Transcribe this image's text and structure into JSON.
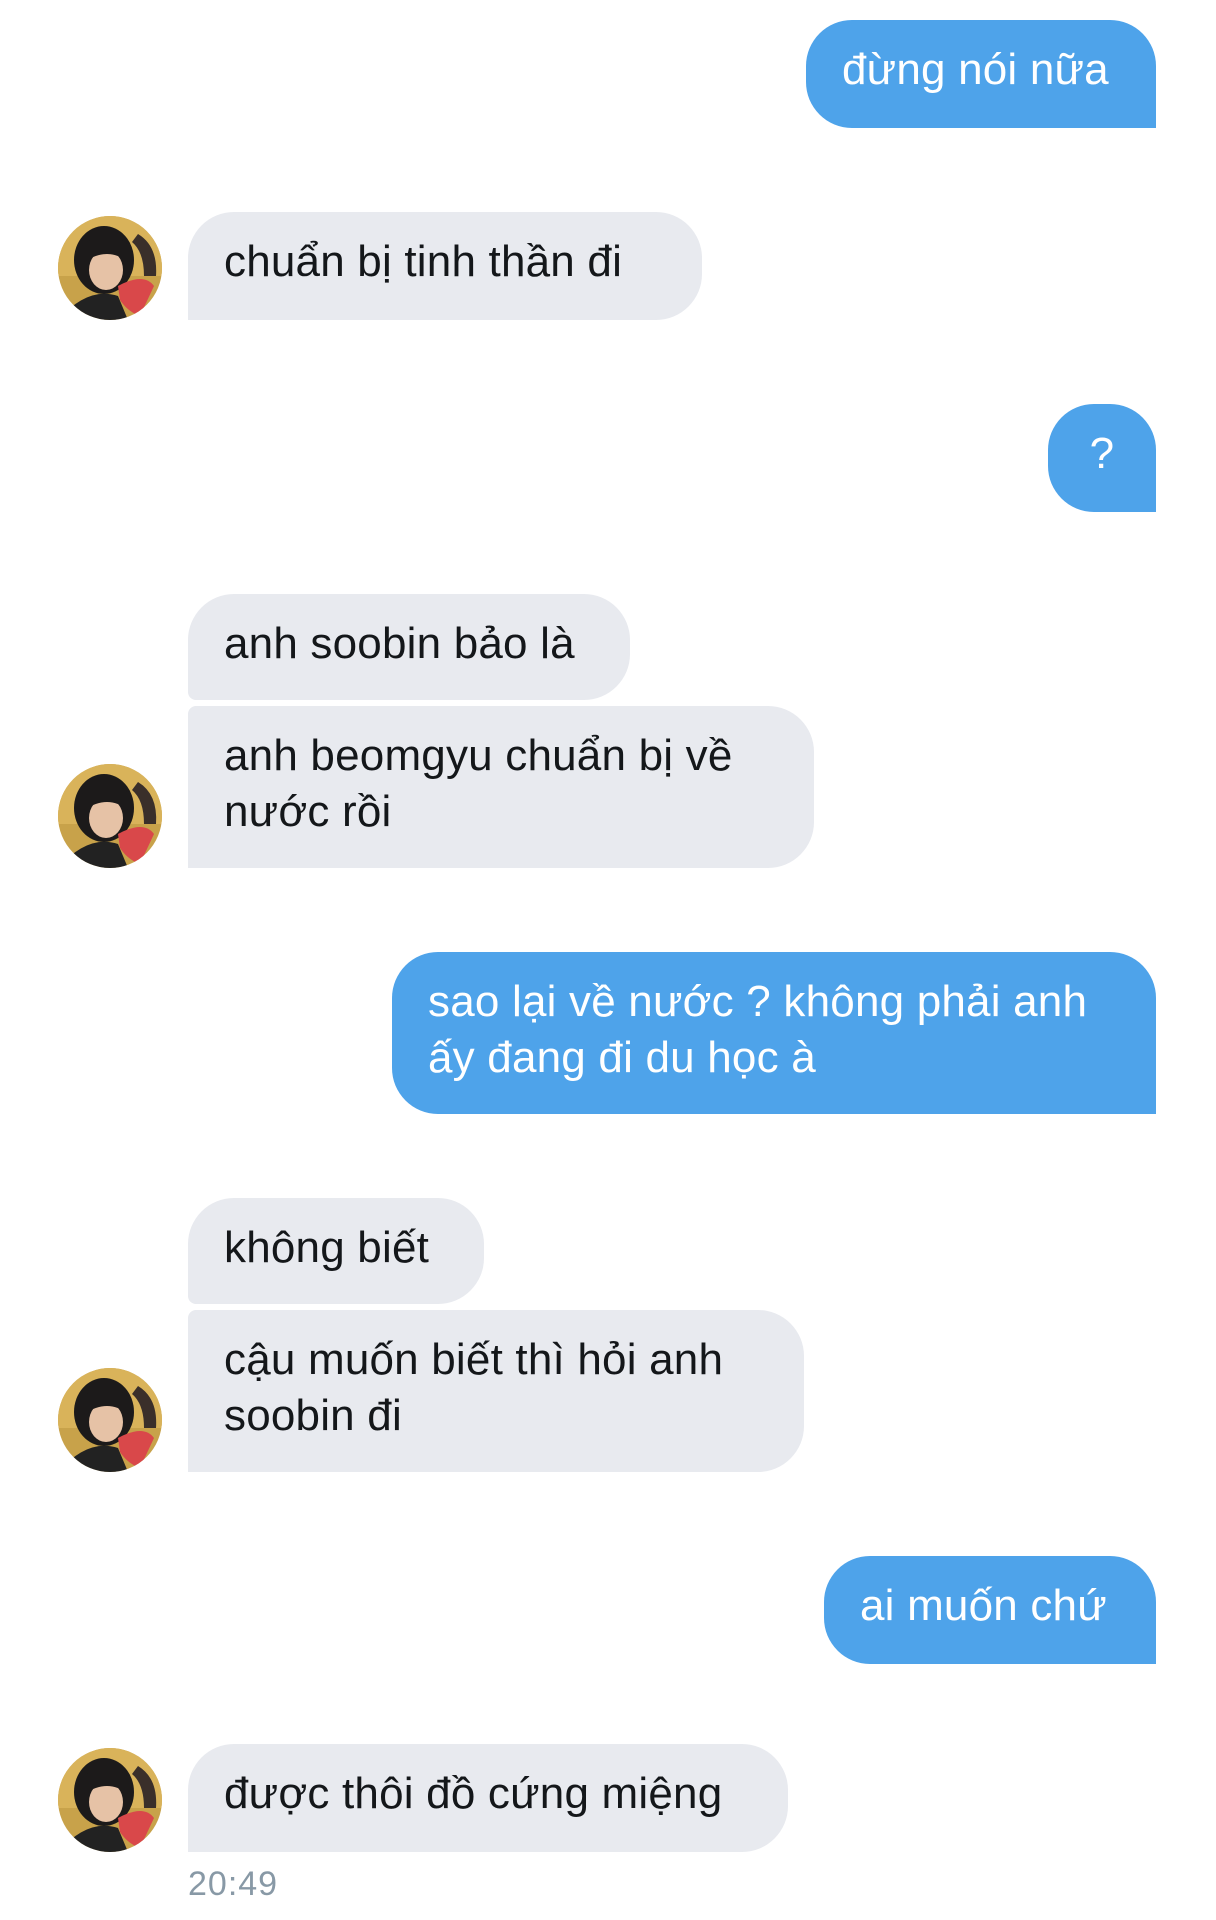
{
  "conversation": {
    "messages": [
      {
        "direction": "outgoing",
        "text": "đừng nói nữa"
      },
      {
        "direction": "incoming",
        "text": "chuẩn bị tinh thần đi"
      },
      {
        "direction": "outgoing",
        "text": "?"
      },
      {
        "direction": "incoming",
        "text": "anh soobin bảo là"
      },
      {
        "direction": "incoming",
        "text": "anh beomgyu chuẩn bị về nước rồi"
      },
      {
        "direction": "outgoing",
        "text": "sao lại về nước ? không phải anh ấy đang đi du học à"
      },
      {
        "direction": "incoming",
        "text": "không biết"
      },
      {
        "direction": "incoming",
        "text": "cậu muốn biết thì hỏi anh soobin đi"
      },
      {
        "direction": "outgoing",
        "text": "ai muốn chứ"
      },
      {
        "direction": "incoming",
        "text": "được thôi đồ cứng miệng"
      }
    ],
    "last_timestamp": "20:49"
  },
  "colors": {
    "outgoing_bubble": "#4ea3ea",
    "incoming_bubble": "#e8eaef",
    "timestamp_text": "#8899a6"
  },
  "icons": {
    "avatar": "contact-avatar-photo"
  }
}
